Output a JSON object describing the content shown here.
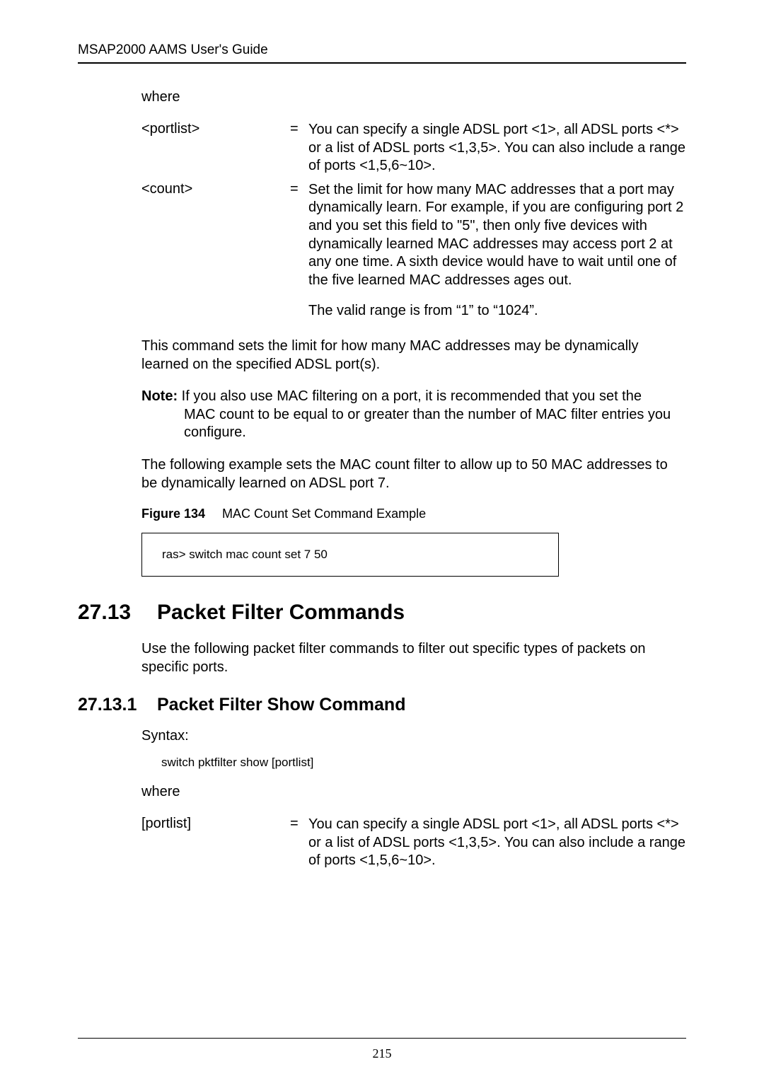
{
  "header": {
    "title": "MSAP2000 AAMS User's Guide"
  },
  "section1": {
    "where": "where",
    "defs": [
      {
        "term": "<portlist>",
        "eq": "=",
        "desc": "You can specify a single ADSL port <1>, all ADSL ports <*> or a list of ADSL ports <1,3,5>. You can also include a range of ports <1,5,6~10>."
      },
      {
        "term": "<count>",
        "eq": "=",
        "desc": "Set the limit for how many MAC addresses that a port may dynamically learn. For example, if you are configuring port 2 and you set this field to \"5\", then only five devices with dynamically learned MAC addresses may access port 2 at any one time. A sixth device would have to wait until one of the five learned MAC addresses ages out.",
        "desc2": "The valid range is from “1” to “1024”."
      }
    ],
    "para1": "This command sets the limit for how many MAC addresses may be dynamically learned on the specified ADSL port(s).",
    "note_label": "Note:",
    "note_first": " If you also use MAC filtering on a port, it is recommended that you set the",
    "note_rest": "MAC count to be equal to or greater than the number of MAC filter entries you configure.",
    "para2": "The following example sets the MAC count filter to allow up to 50 MAC addresses to be dynamically learned on ADSL port 7.",
    "fig_label": "Figure 134",
    "fig_caption": "MAC Count Set Command Example",
    "code": "ras> switch mac count set 7 50"
  },
  "section2": {
    "num": "27.13",
    "title": "Packet Filter Commands",
    "para": "Use the following packet filter commands to filter out specific types of packets on specific ports."
  },
  "section3": {
    "num": "27.13.1",
    "title": "Packet Filter Show Command",
    "syntax_label": "Syntax:",
    "syntax_code": "switch pktfilter show [portlist]",
    "where": "where",
    "defs": [
      {
        "term": "[portlist]",
        "eq": "=",
        "desc": "You can specify a single ADSL port <1>, all ADSL ports <*> or a list of ADSL ports <1,3,5>. You can also include a range of ports <1,5,6~10>."
      }
    ]
  },
  "footer": {
    "page_number": "215"
  }
}
